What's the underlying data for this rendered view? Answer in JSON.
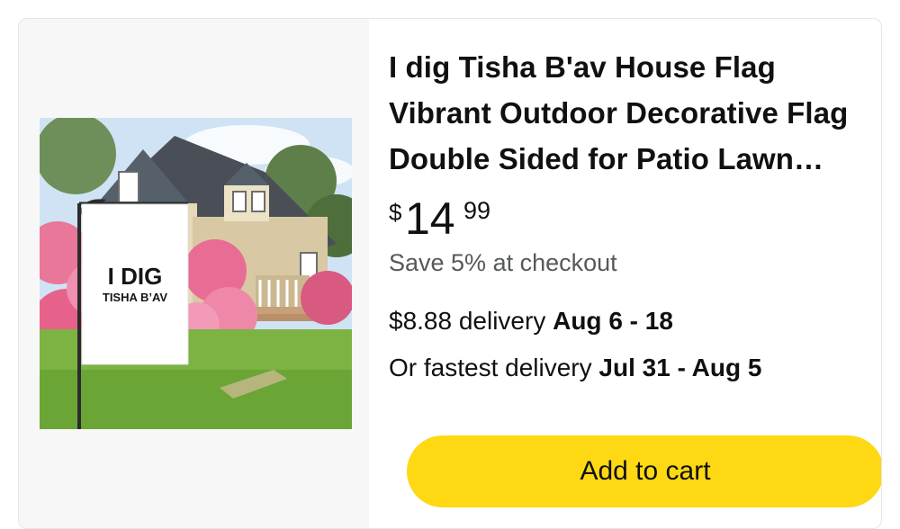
{
  "product": {
    "title_lines": [
      "I dig Tisha B'av House Flag",
      "Vibrant Outdoor Decorative Flag",
      "Double Sided for Patio Lawn…"
    ],
    "image": {
      "flag_line1": "I DIG",
      "flag_line2": "TISHA B’AV"
    },
    "price": {
      "symbol": "$",
      "whole": "14",
      "fraction": "99"
    },
    "savings": "Save 5% at checkout",
    "delivery": {
      "standard_prefix": "$8.88 delivery ",
      "standard_dates": "Aug 6 - 18",
      "fastest_prefix": "Or fastest delivery ",
      "fastest_dates": "Jul 31 - Aug 5"
    },
    "add_to_cart_label": "Add to cart"
  },
  "colors": {
    "button": "#ffd814",
    "text": "#0f1111",
    "muted": "#565959",
    "image_pane_bg": "#f7f7f7"
  }
}
